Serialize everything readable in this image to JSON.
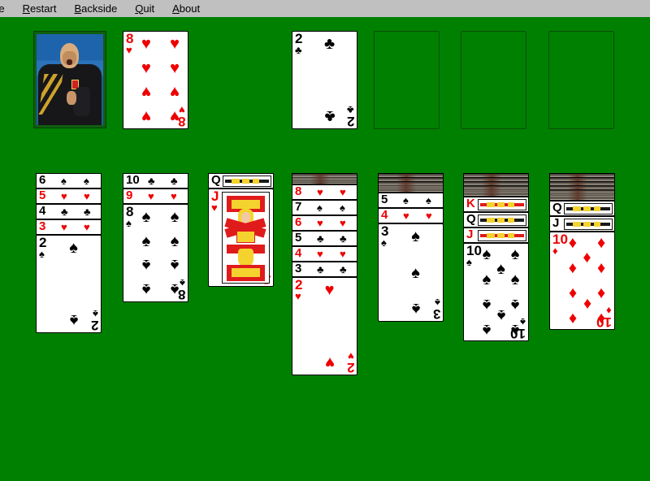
{
  "window": {
    "background_color": "#008000",
    "menubar_color": "#c0c0c0"
  },
  "menu": {
    "items": [
      {
        "label": "re",
        "mnemonic": "",
        "clipped": true
      },
      {
        "label": "Restart",
        "mnemonic": "R"
      },
      {
        "label": "Backside",
        "mnemonic": "B"
      },
      {
        "label": "Quit",
        "mnemonic": "Q"
      },
      {
        "label": "About",
        "mnemonic": "A"
      }
    ]
  },
  "suits": {
    "hearts": "♥",
    "diamonds": "♦",
    "clubs": "♣",
    "spades": "♠"
  },
  "colors": {
    "red": "#ee0000",
    "black": "#000000",
    "felt": "#008000",
    "slot_border": "#0b4d0b"
  },
  "stock": {
    "name": "stock-pile",
    "card_back": "photo-athlete",
    "description": "photo card back"
  },
  "waste": {
    "card": {
      "rank": "8",
      "suit": "hearts",
      "color": "red"
    }
  },
  "foundations": [
    {
      "index": 1,
      "empty": false,
      "card": {
        "rank": "2",
        "suit": "clubs",
        "color": "black"
      }
    },
    {
      "index": 2,
      "empty": true
    },
    {
      "index": 3,
      "empty": true
    },
    {
      "index": 4,
      "empty": true
    }
  ],
  "tableau": [
    {
      "column": 1,
      "facedown_count": 0,
      "cards": [
        {
          "rank": "6",
          "suit": "spades",
          "color": "black",
          "covered": true
        },
        {
          "rank": "5",
          "suit": "hearts",
          "color": "red",
          "covered": true
        },
        {
          "rank": "4",
          "suit": "clubs",
          "color": "black",
          "covered": true
        },
        {
          "rank": "3",
          "suit": "hearts",
          "color": "red",
          "covered": true
        },
        {
          "rank": "2",
          "suit": "spades",
          "color": "black",
          "covered": false
        }
      ]
    },
    {
      "column": 2,
      "facedown_count": 0,
      "cards": [
        {
          "rank": "10",
          "suit": "clubs",
          "color": "black",
          "covered": true
        },
        {
          "rank": "9",
          "suit": "hearts",
          "color": "red",
          "covered": true
        },
        {
          "rank": "8",
          "suit": "spades",
          "color": "black",
          "covered": false
        }
      ]
    },
    {
      "column": 3,
      "facedown_count": 0,
      "cards": [
        {
          "rank": "Q",
          "suit": "spades",
          "color": "black",
          "covered": true,
          "court": true
        },
        {
          "rank": "J",
          "suit": "hearts",
          "color": "red",
          "covered": false,
          "court": true
        }
      ]
    },
    {
      "column": 4,
      "facedown_count": 1,
      "cards": [
        {
          "rank": "8",
          "suit": "hearts",
          "color": "red",
          "covered": true
        },
        {
          "rank": "7",
          "suit": "spades",
          "color": "black",
          "covered": true
        },
        {
          "rank": "6",
          "suit": "hearts",
          "color": "red",
          "covered": true
        },
        {
          "rank": "5",
          "suit": "clubs",
          "color": "black",
          "covered": true
        },
        {
          "rank": "4",
          "suit": "hearts",
          "color": "red",
          "covered": true
        },
        {
          "rank": "3",
          "suit": "clubs",
          "color": "black",
          "covered": true
        },
        {
          "rank": "2",
          "suit": "hearts",
          "color": "red",
          "covered": false
        }
      ]
    },
    {
      "column": 5,
      "facedown_count": 3,
      "cards": [
        {
          "rank": "5",
          "suit": "spades",
          "color": "black",
          "covered": true
        },
        {
          "rank": "4",
          "suit": "hearts",
          "color": "red",
          "covered": true
        },
        {
          "rank": "3",
          "suit": "spades",
          "color": "black",
          "covered": false
        }
      ]
    },
    {
      "column": 6,
      "facedown_count": 4,
      "cards": [
        {
          "rank": "K",
          "suit": "hearts",
          "color": "red",
          "covered": true,
          "court": true
        },
        {
          "rank": "Q",
          "suit": "spades",
          "color": "black",
          "covered": true,
          "court": true
        },
        {
          "rank": "J",
          "suit": "hearts",
          "color": "red",
          "covered": true,
          "court": true
        },
        {
          "rank": "10",
          "suit": "spades",
          "color": "black",
          "covered": false
        }
      ]
    },
    {
      "column": 7,
      "facedown_count": 5,
      "cards": [
        {
          "rank": "Q",
          "suit": "spades",
          "color": "black",
          "covered": true,
          "court": true
        },
        {
          "rank": "J",
          "suit": "spades",
          "color": "black",
          "covered": true,
          "court": true
        },
        {
          "rank": "10",
          "suit": "diamonds",
          "color": "red",
          "covered": false
        }
      ]
    }
  ]
}
